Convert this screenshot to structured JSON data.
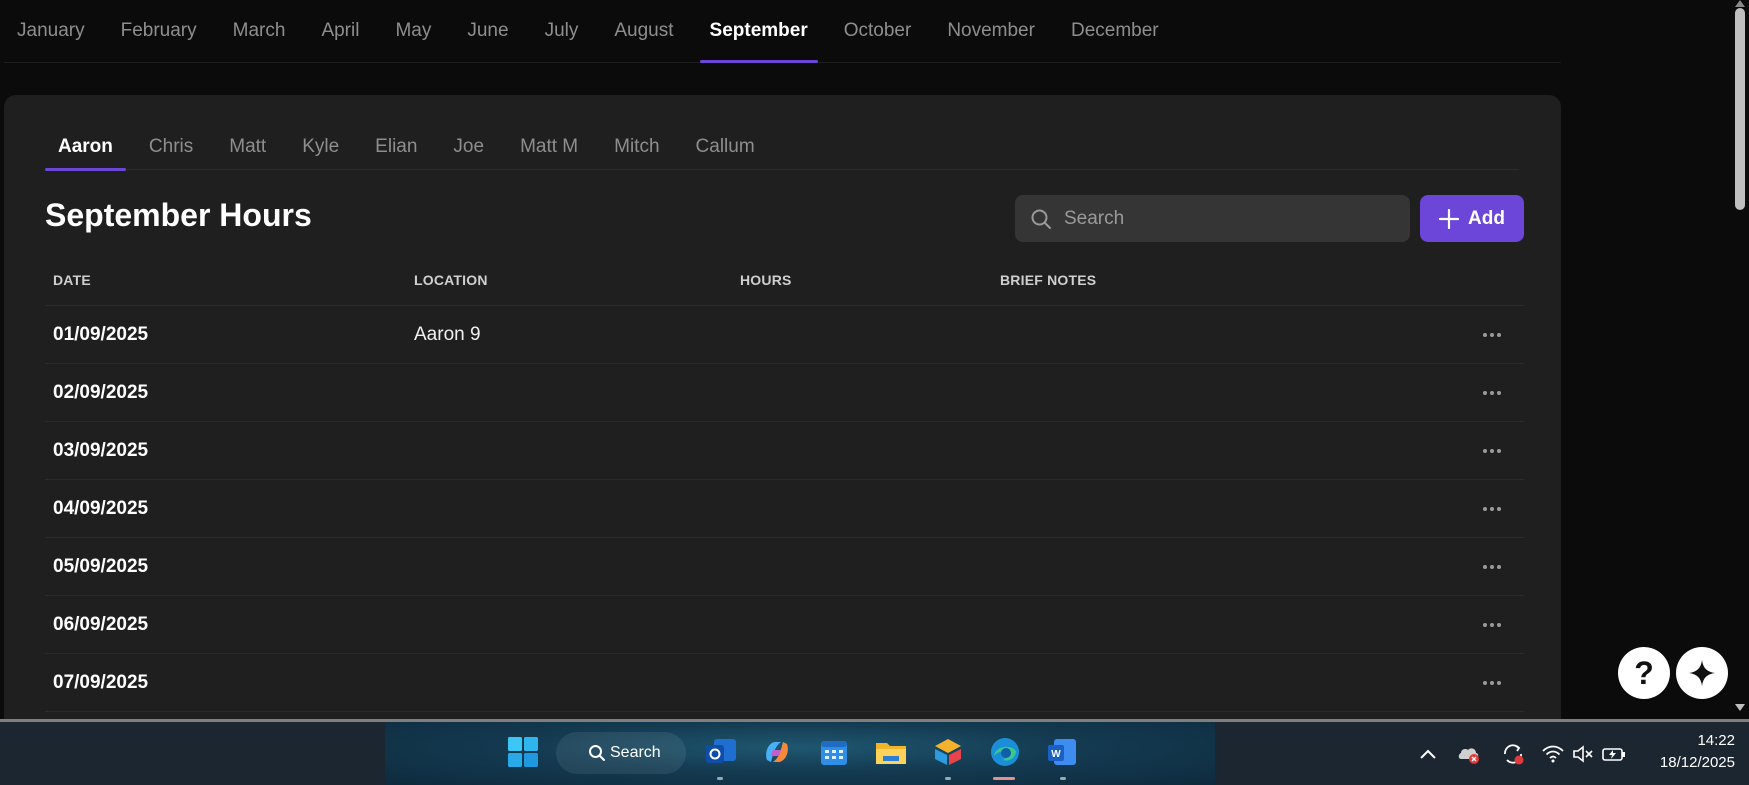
{
  "months": [
    "January",
    "February",
    "March",
    "April",
    "May",
    "June",
    "July",
    "August",
    "September",
    "October",
    "November",
    "December"
  ],
  "active_month": "September",
  "people": [
    "Aaron",
    "Chris",
    "Matt",
    "Kyle",
    "Elian",
    "Joe",
    "Matt M",
    "Mitch",
    "Callum"
  ],
  "active_person": "Aaron",
  "page_title": "September Hours",
  "search": {
    "placeholder": "Search"
  },
  "add_button": {
    "label": "Add"
  },
  "table": {
    "headers": {
      "date": "DATE",
      "location": "LOCATION",
      "hours": "HOURS",
      "notes": "BRIEF NOTES"
    },
    "rows": [
      {
        "date": "01/09/2025",
        "location": "Aaron 9",
        "hours": "",
        "notes": ""
      },
      {
        "date": "02/09/2025",
        "location": "",
        "hours": "",
        "notes": ""
      },
      {
        "date": "03/09/2025",
        "location": "",
        "hours": "",
        "notes": ""
      },
      {
        "date": "04/09/2025",
        "location": "",
        "hours": "",
        "notes": ""
      },
      {
        "date": "05/09/2025",
        "location": "",
        "hours": "",
        "notes": ""
      },
      {
        "date": "06/09/2025",
        "location": "",
        "hours": "",
        "notes": ""
      },
      {
        "date": "07/09/2025",
        "location": "",
        "hours": "",
        "notes": ""
      }
    ]
  },
  "floating": {
    "help_label": "?"
  },
  "taskbar": {
    "search_label": "Search",
    "time": "14:22",
    "date": "18/12/2025"
  },
  "colors": {
    "accent": "#6b46d9",
    "panel": "#1f1f1f",
    "background": "#0b0b0b"
  }
}
